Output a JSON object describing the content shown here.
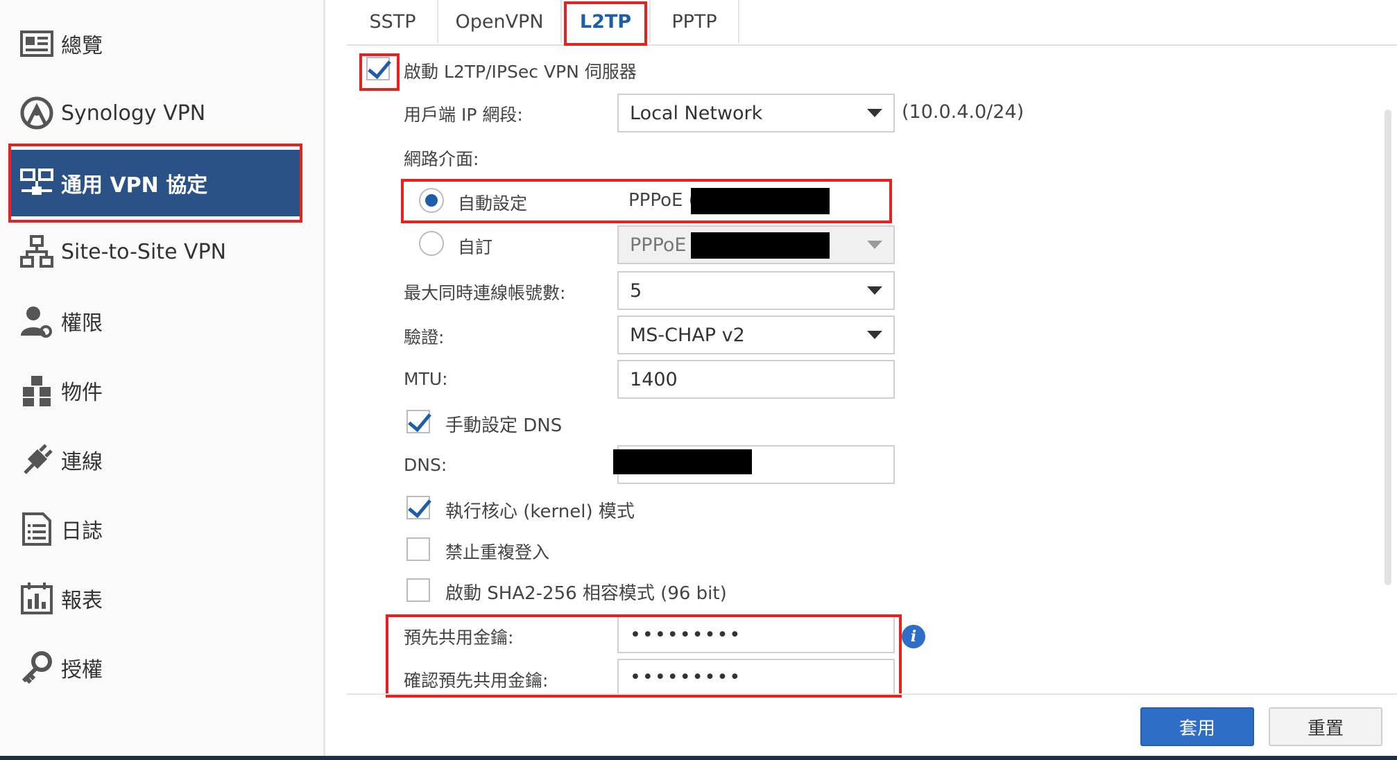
{
  "sidebar": {
    "items": [
      {
        "label": "總覽",
        "icon": "overview-card-icon"
      },
      {
        "label": "Synology VPN",
        "icon": "synology-vpn-icon"
      },
      {
        "label": "通用 VPN 協定",
        "icon": "vpn-protocol-icon",
        "active": true
      },
      {
        "label": "Site-to-Site VPN",
        "icon": "site-to-site-icon"
      },
      {
        "label": "權限",
        "icon": "user-permission-icon"
      },
      {
        "label": "物件",
        "icon": "objects-cubes-icon"
      },
      {
        "label": "連線",
        "icon": "connection-plug-icon"
      },
      {
        "label": "日誌",
        "icon": "log-document-icon"
      },
      {
        "label": "報表",
        "icon": "report-chart-icon"
      },
      {
        "label": "授權",
        "icon": "license-key-icon"
      }
    ]
  },
  "tabs": [
    {
      "label": "SSTP"
    },
    {
      "label": "OpenVPN"
    },
    {
      "label": "L2TP",
      "active": true
    },
    {
      "label": "PPTP"
    }
  ],
  "form": {
    "enable_server": {
      "label": "啟動 L2TP/IPSec VPN 伺服器",
      "checked": true
    },
    "client_ip": {
      "label": "用戶端 IP 網段:",
      "value": "Local Network",
      "note": "(10.0.4.0/24)"
    },
    "interface": {
      "label": "網路介面:",
      "auto": {
        "label": "自動設定",
        "value": "PPPoE (",
        "selected": true
      },
      "manual": {
        "label": "自訂",
        "value": "PPPoE (",
        "selected": false
      }
    },
    "max_connections": {
      "label": "最大同時連線帳號數:",
      "value": "5"
    },
    "auth": {
      "label": "驗證:",
      "value": "MS-CHAP v2"
    },
    "mtu": {
      "label": "MTU:",
      "value": "1400"
    },
    "manual_dns": {
      "label": "手動設定 DNS",
      "checked": true
    },
    "dns": {
      "label": "DNS:",
      "value": ""
    },
    "kernel_mode": {
      "label": "執行核心 (kernel) 模式",
      "checked": true
    },
    "no_dup_login": {
      "label": "禁止重複登入",
      "checked": false
    },
    "sha2": {
      "label": "啟動 SHA2-256 相容模式 (96 bit)",
      "checked": false
    },
    "psk": {
      "label": "預先共用金鑰:",
      "value": "•••••••••"
    },
    "psk_confirm": {
      "label": "確認預先共用金鑰:",
      "value": "•••••••••"
    },
    "info_glyph": "i"
  },
  "buttons": {
    "apply": "套用",
    "reset": "重置"
  },
  "colors": {
    "accent": "#2b5287",
    "highlight": "#e8201e",
    "button": "#2f6ec6"
  }
}
